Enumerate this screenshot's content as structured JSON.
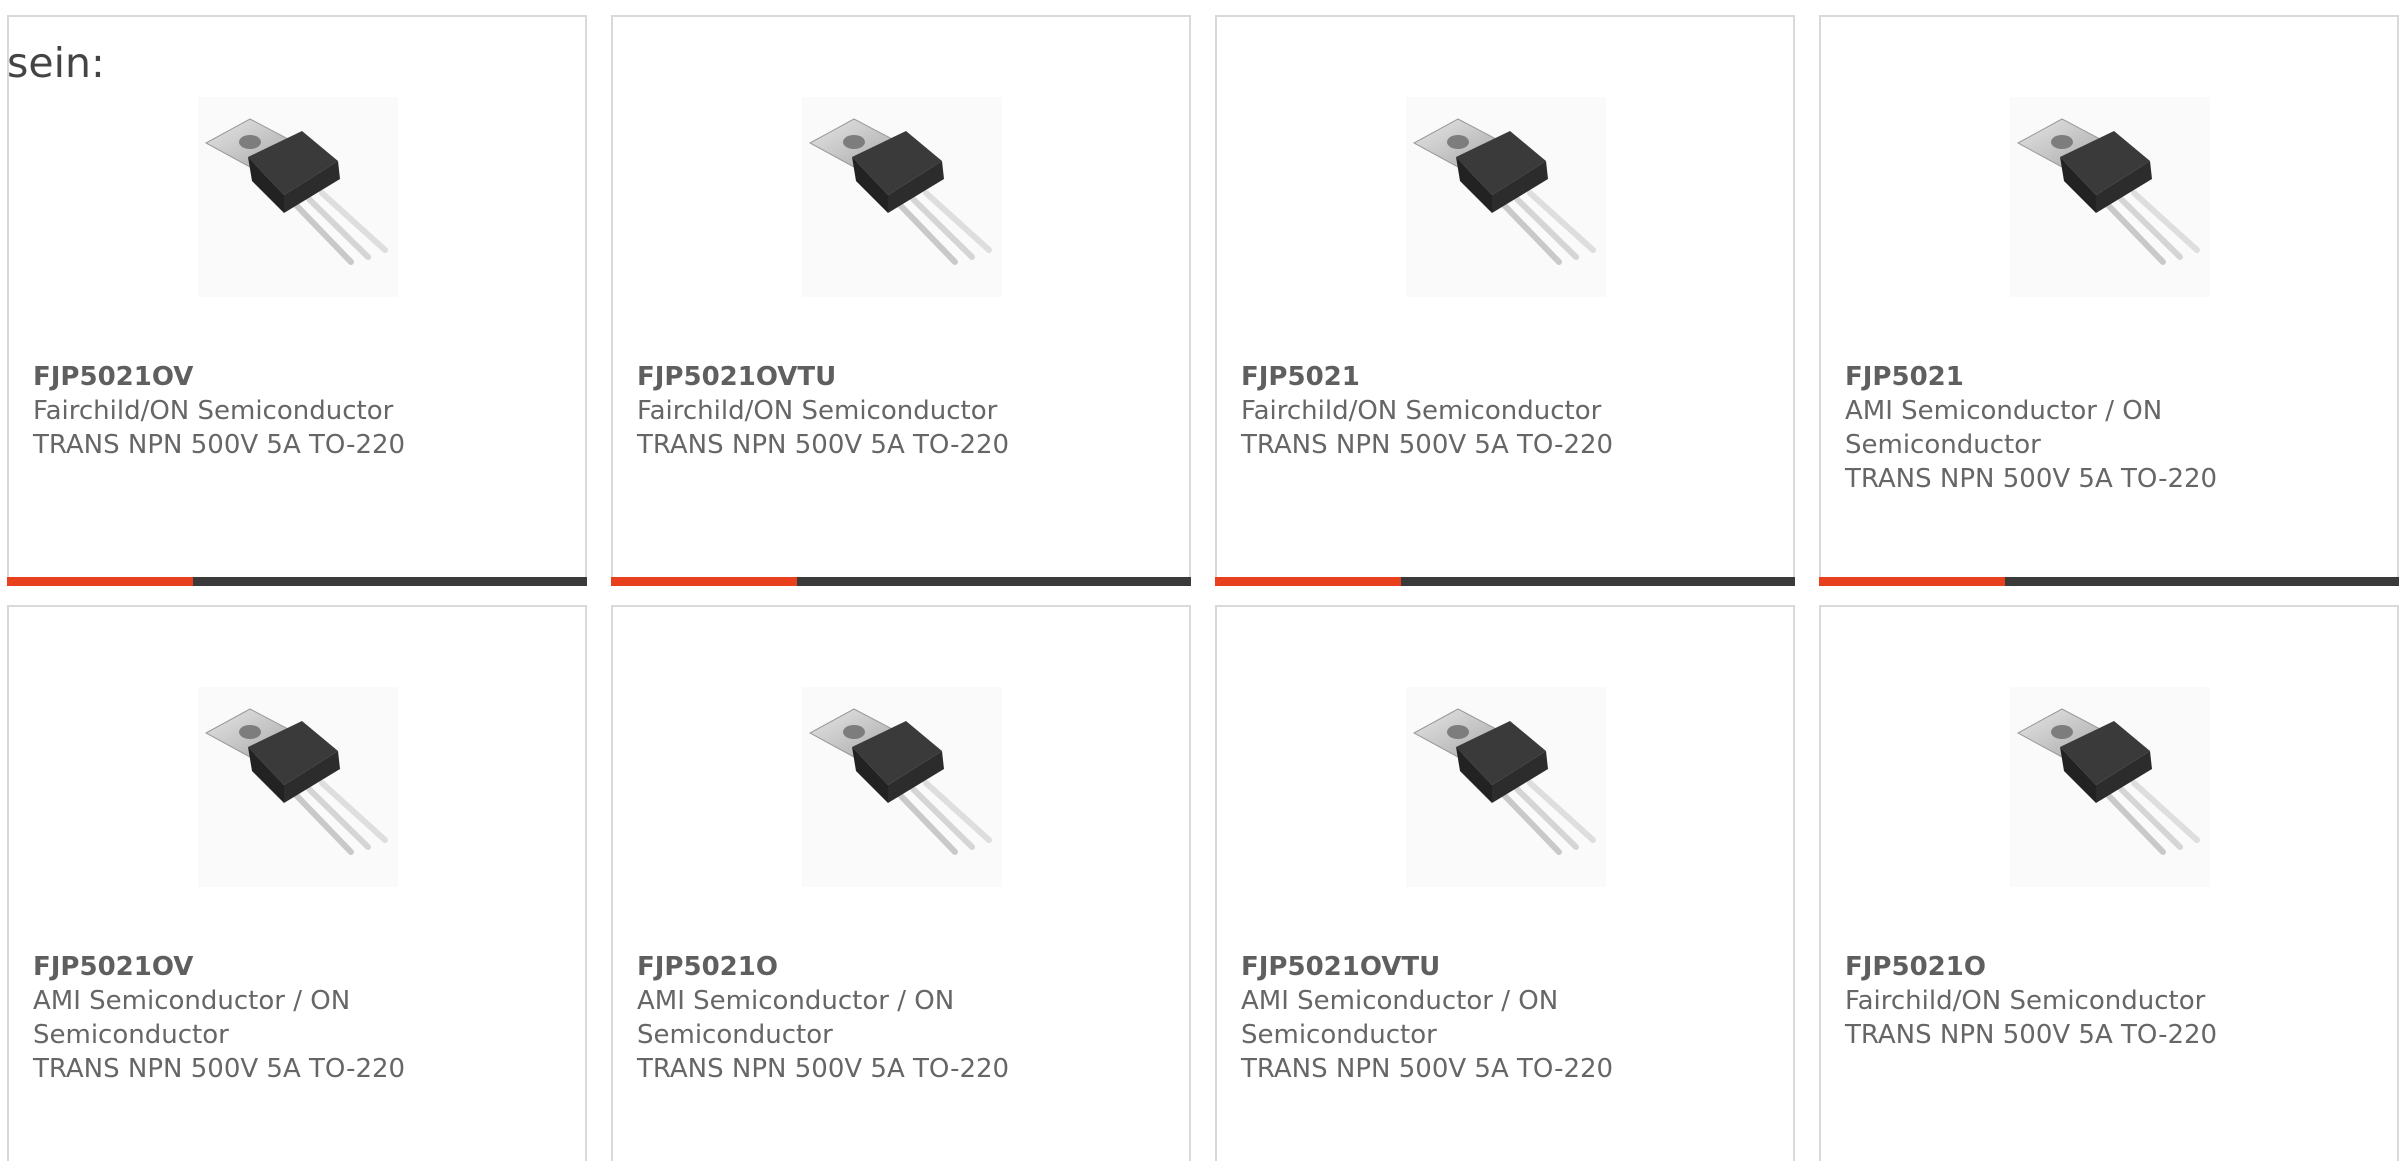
{
  "intro": "sein:",
  "colors": {
    "accent": "#e8401c",
    "bar_track": "#3a3a3a",
    "card_border": "#d9d9d9",
    "text": "#666666"
  },
  "cards": [
    {
      "part": "FJP5021OV",
      "manufacturer": "Fairchild/ON Semiconductor",
      "description": "TRANS NPN 500V 5A TO-220",
      "image_icon": "transistor-to220-image",
      "progress_fraction": 0.32
    },
    {
      "part": "FJP5021OVTU",
      "manufacturer": "Fairchild/ON Semiconductor",
      "description": "TRANS NPN 500V 5A TO-220",
      "image_icon": "transistor-to220-image",
      "progress_fraction": 0.32
    },
    {
      "part": "FJP5021",
      "manufacturer": "Fairchild/ON Semiconductor",
      "description": "TRANS NPN 500V 5A TO-220",
      "image_icon": "transistor-to220-image",
      "progress_fraction": 0.32
    },
    {
      "part": "FJP5021",
      "manufacturer": "AMI Semiconductor / ON Semiconductor",
      "description": "TRANS NPN 500V 5A TO-220",
      "image_icon": "transistor-to220-image",
      "progress_fraction": 0.32
    },
    {
      "part": "FJP5021OV",
      "manufacturer": "AMI Semiconductor / ON Semiconductor",
      "description": "TRANS NPN 500V 5A TO-220",
      "image_icon": "transistor-to220-image"
    },
    {
      "part": "FJP5021O",
      "manufacturer": "AMI Semiconductor / ON Semiconductor",
      "description": "TRANS NPN 500V 5A TO-220",
      "image_icon": "transistor-to220-image"
    },
    {
      "part": "FJP5021OVTU",
      "manufacturer": "AMI Semiconductor / ON Semiconductor",
      "description": "TRANS NPN 500V 5A TO-220",
      "image_icon": "transistor-to220-image"
    },
    {
      "part": "FJP5021O",
      "manufacturer": "Fairchild/ON Semiconductor",
      "description": "TRANS NPN 500V 5A TO-220",
      "image_icon": "transistor-to220-image"
    }
  ]
}
